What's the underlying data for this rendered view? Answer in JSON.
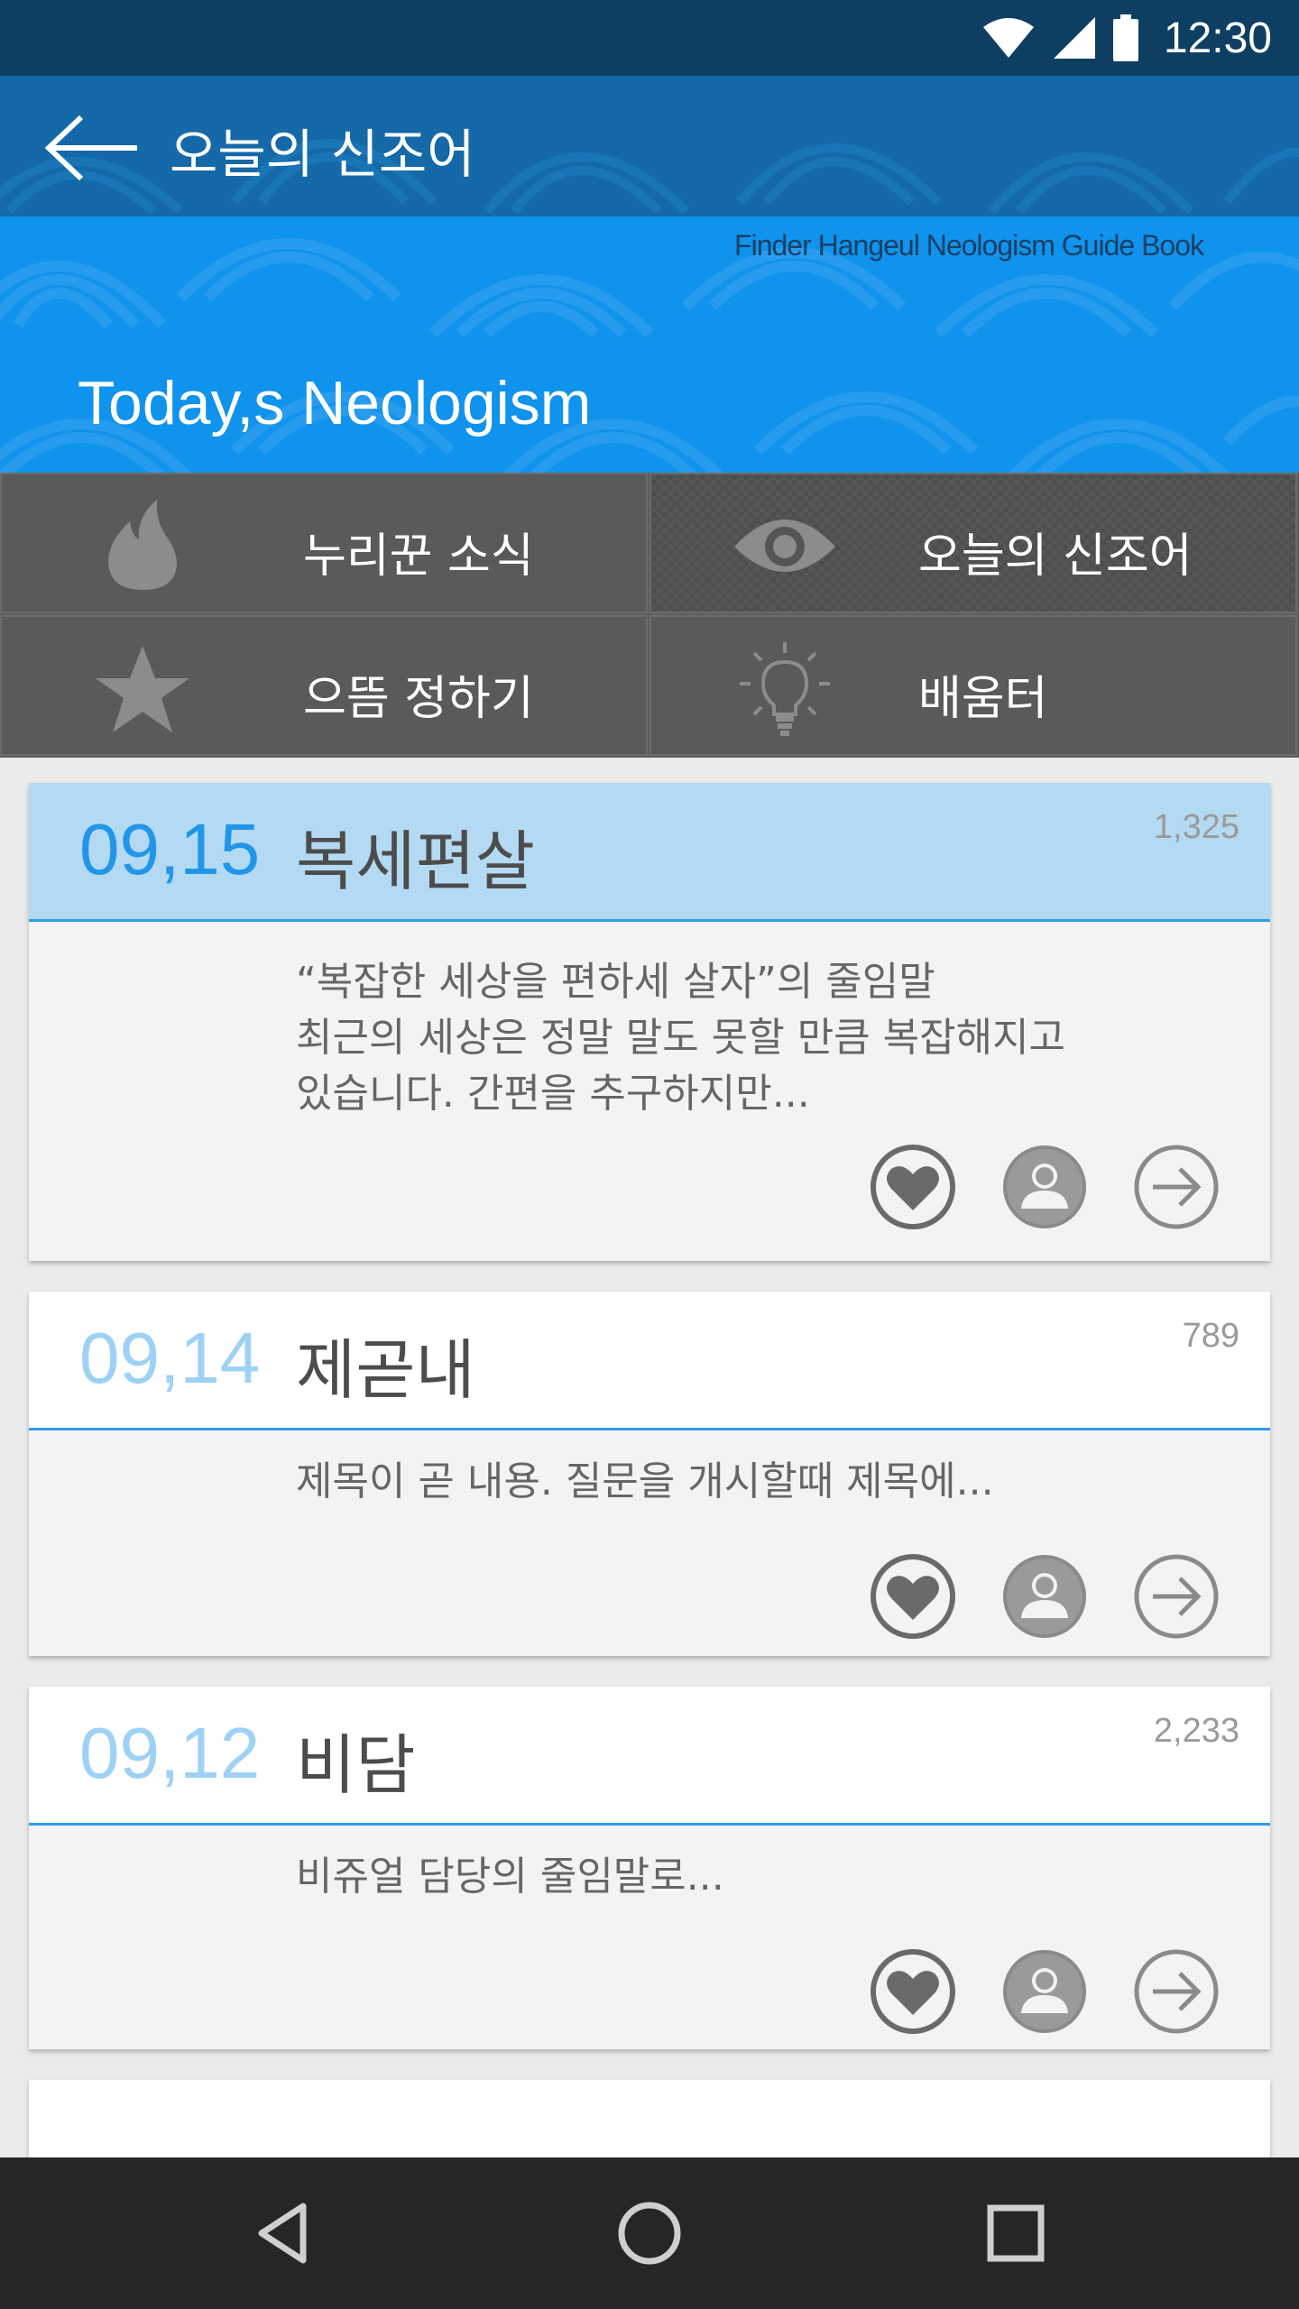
{
  "status_bar": {
    "time": "12:30"
  },
  "toolbar": {
    "title": "오늘의 신조어"
  },
  "banner": {
    "subtitle": "Finder Hangeul Neologism Guide Book",
    "headline": "Today,s Neologism"
  },
  "menu": {
    "items": [
      {
        "label": "누리꾼 소식",
        "icon": "flame-icon"
      },
      {
        "label": "오늘의 신조어",
        "icon": "eye-icon"
      },
      {
        "label": "으뜸 정하기",
        "icon": "star-icon"
      },
      {
        "label": "배움터",
        "icon": "lightbulb-icon"
      }
    ],
    "active_index": 1
  },
  "cards": [
    {
      "date": "09,15",
      "word": "복세편살",
      "count": "1,325",
      "lines": [
        "“복잡한 세상을 편하세 살자”의 줄임말",
        "최근의 세상은 정말 말도 못할 만큼 복잡해지고",
        "있습니다. 간편을 추구하지만..."
      ]
    },
    {
      "date": "09,14",
      "word": "제곧내",
      "count": "789",
      "lines": [
        "제목이 곧 내용. 질문을 개시할때 제목에..."
      ]
    },
    {
      "date": "09,12",
      "word": "비담",
      "count": "2,233",
      "lines": [
        "비쥬얼 담당의 줄임말로..."
      ]
    }
  ],
  "card_actions": [
    "heart-icon",
    "user-icon",
    "arrow-right-icon"
  ],
  "colors": {
    "status_bar": "#0e3f63",
    "toolbar": "#1569a8",
    "banner": "#0f93ec",
    "menu": "#5a5a5a",
    "accent": "#2196e8",
    "highlight": "#b3daf2",
    "nav_bar": "#262626"
  }
}
